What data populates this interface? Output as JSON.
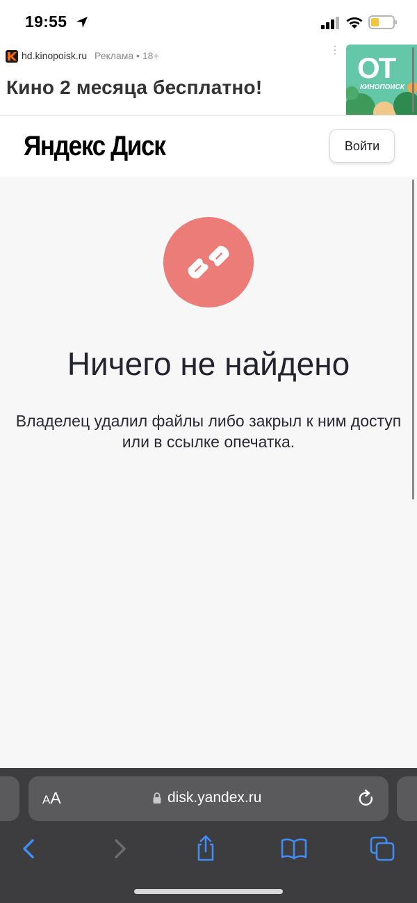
{
  "status_bar": {
    "time": "19:55",
    "icons": [
      "location-arrow-icon",
      "cellular-signal-icon",
      "wifi-icon",
      "battery-low-icon"
    ]
  },
  "ad": {
    "domain": "hd.kinopoisk.ru",
    "meta": "Реклама • 18+",
    "headline": "Кино 2 месяца бесплатно!",
    "more": "⋮",
    "image_text_big": "ОТ",
    "image_text_small": "КИНОПОИСК"
  },
  "header": {
    "logo": "Яндекс Диск",
    "login_label": "Войти"
  },
  "error": {
    "icon": "broken-link-icon",
    "color": "#ec7c77",
    "title": "Ничего не найдено",
    "description": "Владелец удалил файлы либо закрыл к ним доступ или в ссылке опечатка."
  },
  "browser": {
    "text_size_small": "A",
    "text_size_big": "A",
    "url": "disk.yandex.ru",
    "toolbar_icons": [
      "back-icon",
      "forward-icon",
      "share-icon",
      "bookmarks-icon",
      "tabs-icon"
    ],
    "accent": "#3f8ef7"
  }
}
